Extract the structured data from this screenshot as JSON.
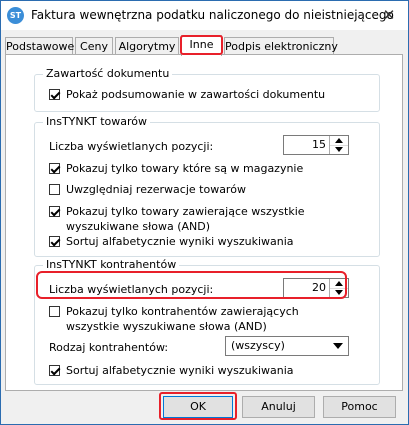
{
  "window": {
    "title": "Faktura wewnętrzna podatku naliczonego do nieistniejącego",
    "icon_text": "ST",
    "close_glyph": "✕"
  },
  "tabs": [
    {
      "label": "Podstawowe",
      "active": false
    },
    {
      "label": "Ceny",
      "active": false
    },
    {
      "label": "Algorytmy",
      "active": false
    },
    {
      "label": "Inne",
      "active": true
    },
    {
      "label": "Podpis elektroniczny",
      "active": false
    }
  ],
  "document_group": {
    "title": "Zawartość dokumentu",
    "show_summary": {
      "label": "Pokaż podsumowanie w zawartości dokumentu",
      "checked": true
    }
  },
  "instynkt_goods": {
    "title": "InsTYNKT towarów",
    "count_label": "Liczba wyświetlanych pozycji:",
    "count_value": "15",
    "options": [
      {
        "label": "Pokazuj tylko towary które są w magazynie",
        "checked": true
      },
      {
        "label": "Uwzględniaj rezerwacje towarów",
        "checked": false
      },
      {
        "label": "Pokazuj tylko towary zawierające wszystkie wyszukiwane słowa (AND)",
        "checked": true
      },
      {
        "label": "Sortuj alfabetycznie wyniki wyszukiwania",
        "checked": true
      }
    ]
  },
  "instynkt_contractors": {
    "title": "InsTYNKT kontrahentów",
    "count_label": "Liczba wyświetlanych pozycji:",
    "count_value": "20",
    "only_all_words": {
      "label": "Pokazuj tylko kontrahentów zawierających wszystkie wyszukiwane słowa (AND)",
      "checked": false
    },
    "kind_label": "Rodzaj kontrahentów:",
    "kind_value": "(wszyscy)",
    "sort_alpha": {
      "label": "Sortuj alfabetycznie wyniki wyszukiwania",
      "checked": true
    }
  },
  "buttons": {
    "ok": "OK",
    "cancel": "Anuluj",
    "help": "Pomoc"
  },
  "colors": {
    "highlight": "#e8202a",
    "accent": "#0078d7"
  }
}
